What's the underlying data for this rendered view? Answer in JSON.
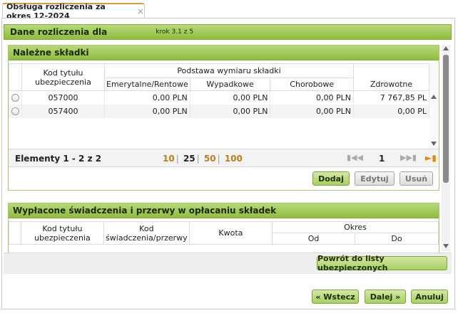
{
  "tab": {
    "title": "Obsługa rozliczenia za okres 12-2024",
    "close": "×"
  },
  "header": {
    "title": "Dane rozliczenia dla",
    "step": "krok 3.1 z 5"
  },
  "panel_contributions": {
    "title": "Należne składki",
    "columns": {
      "code": "Kod tytułu ubezpieczenia",
      "base_group": "Podstawa wymiaru składki",
      "pension": "Emerytalne/Rentowe",
      "accident": "Wypadkowe",
      "sickness": "Chorobowe",
      "health": "Zdrowotne"
    },
    "rows": [
      {
        "code": "057000",
        "pension": "0,00 PLN",
        "accident": "0,00 PLN",
        "sickness": "0,00 PLN",
        "health": "7 767,85 PL"
      },
      {
        "code": "057400",
        "pension": "0,00 PLN",
        "accident": "0,00 PLN",
        "sickness": "0,00 PLN",
        "health": "0,00 PL"
      }
    ],
    "pager": {
      "count": "Elementy 1 - 2 z 2",
      "sizes": [
        "10",
        "25",
        "50",
        "100"
      ],
      "selected_size": "25",
      "page": "1"
    },
    "buttons": {
      "add": "Dodaj",
      "edit": "Edytuj",
      "delete": "Usuń"
    }
  },
  "panel_benefits": {
    "title": "Wypłacone świadczenia i przerwy w opłacaniu składek",
    "columns": {
      "code": "Kod tytułu ubezpieczenia",
      "benefit_code": "Kod świadczenia/przerwy",
      "amount": "Kwota",
      "period": "Okres",
      "from": "Od",
      "to": "Do"
    }
  },
  "back_to_list": "Powrót do listy ubezpieczonych",
  "nav": {
    "back": "« Wstecz",
    "next": "Dalej »",
    "cancel": "Anuluj"
  },
  "colors": {
    "accent_green": "#8fbd3f",
    "link_orange": "#c07a1a"
  }
}
